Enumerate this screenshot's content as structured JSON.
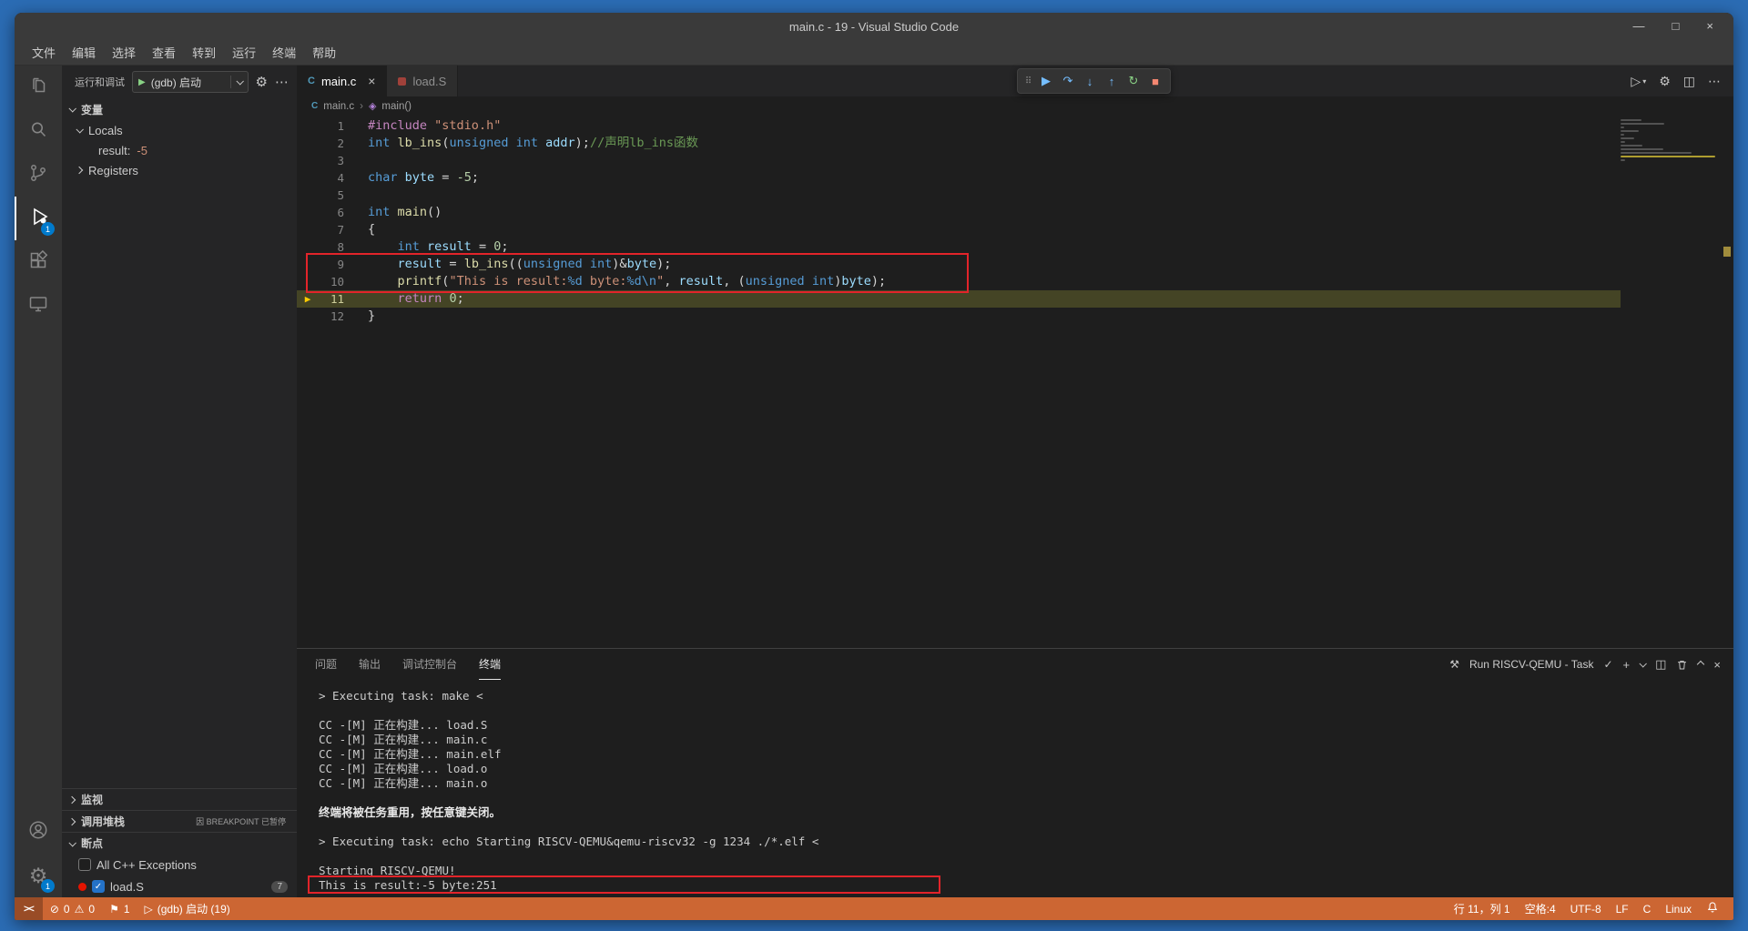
{
  "colors": {
    "frame": "#2b6cb4",
    "statusbar": "#cc6633",
    "annotation": "#e2242a",
    "badge": "#007acc",
    "current_line_arrow": "#ffcc00"
  },
  "window": {
    "title": "main.c - 19 - Visual Studio Code",
    "controls": {
      "minimize": "—",
      "maximize": "□",
      "close": "×"
    }
  },
  "menu": {
    "items": [
      "文件",
      "编辑",
      "选择",
      "查看",
      "转到",
      "运行",
      "终端",
      "帮助"
    ]
  },
  "activity_badges": {
    "debug": "1",
    "settings": "1"
  },
  "sidebar": {
    "title": "运行和调试",
    "launch_config": "(gdb) 启动",
    "variables_label": "变量",
    "locals_label": "Locals",
    "registers_label": "Registers",
    "variables": [
      {
        "name": "result:",
        "value": "-5"
      }
    ],
    "watch_label": "监视",
    "callstack_label": "调用堆栈",
    "callstack_desc": "因 BREAKPOINT 已暂停",
    "breakpoints_label": "断点",
    "breakpoints": [
      {
        "label": "All C++ Exceptions",
        "checked": false
      },
      {
        "label": "load.S",
        "checked": true,
        "badge": "7"
      }
    ]
  },
  "tabs": [
    {
      "label": "main.c"
    },
    {
      "label": "load.S"
    }
  ],
  "breadcrumb": {
    "file": "main.c",
    "symbol": "main()"
  },
  "debug_toolbar": {
    "buttons": [
      "continue",
      "step-over",
      "step-into",
      "step-out",
      "restart",
      "stop"
    ]
  },
  "editor_actions": [
    "run",
    "settings",
    "split-editor",
    "more-actions"
  ],
  "editor": {
    "current_line": 11,
    "lines": [
      {
        "num": 1,
        "tokens": [
          [
            "pp",
            "#include"
          ],
          [
            "pln",
            " "
          ],
          [
            "str",
            "\"stdio.h\""
          ]
        ]
      },
      {
        "num": 2,
        "tokens": [
          [
            "kw",
            "int"
          ],
          [
            "pln",
            " "
          ],
          [
            "fn",
            "lb_ins"
          ],
          [
            "pln",
            "("
          ],
          [
            "kw",
            "unsigned"
          ],
          [
            "pln",
            " "
          ],
          [
            "kw",
            "int"
          ],
          [
            "pln",
            " "
          ],
          [
            "var",
            "addr"
          ],
          [
            "pln",
            ");"
          ],
          [
            "cmt",
            "//声明lb_ins函数"
          ]
        ]
      },
      {
        "num": 3,
        "tokens": []
      },
      {
        "num": 4,
        "tokens": [
          [
            "kw",
            "char"
          ],
          [
            "pln",
            " "
          ],
          [
            "var",
            "byte"
          ],
          [
            "pln",
            " = "
          ],
          [
            "num",
            "-5"
          ],
          [
            "pln",
            ";"
          ]
        ]
      },
      {
        "num": 5,
        "tokens": []
      },
      {
        "num": 6,
        "tokens": [
          [
            "kw",
            "int"
          ],
          [
            "pln",
            " "
          ],
          [
            "fn",
            "main"
          ],
          [
            "pln",
            "()"
          ]
        ]
      },
      {
        "num": 7,
        "tokens": [
          [
            "pln",
            "{"
          ]
        ]
      },
      {
        "num": 8,
        "tokens": [
          [
            "pln",
            "    "
          ],
          [
            "kw",
            "int"
          ],
          [
            "pln",
            " "
          ],
          [
            "var",
            "result"
          ],
          [
            "pln",
            " = "
          ],
          [
            "num",
            "0"
          ],
          [
            "pln",
            ";"
          ]
        ]
      },
      {
        "num": 9,
        "tokens": [
          [
            "pln",
            "    "
          ],
          [
            "var",
            "result"
          ],
          [
            "pln",
            " = "
          ],
          [
            "fn",
            "lb_ins"
          ],
          [
            "pln",
            "(("
          ],
          [
            "kw",
            "unsigned"
          ],
          [
            "pln",
            " "
          ],
          [
            "kw",
            "int"
          ],
          [
            "pln",
            ")&"
          ],
          [
            "var",
            "byte"
          ],
          [
            "pln",
            ");"
          ]
        ]
      },
      {
        "num": 10,
        "tokens": [
          [
            "pln",
            "    "
          ],
          [
            "fn",
            "printf"
          ],
          [
            "pln",
            "("
          ],
          [
            "str",
            "\"This is result:"
          ],
          [
            "esc",
            "%d"
          ],
          [
            "str",
            " byte:"
          ],
          [
            "esc",
            "%d"
          ],
          [
            "esc",
            "\\n"
          ],
          [
            "str",
            "\""
          ],
          [
            "pln",
            ", "
          ],
          [
            "var",
            "result"
          ],
          [
            "pln",
            ", ("
          ],
          [
            "kw",
            "unsigned"
          ],
          [
            "pln",
            " "
          ],
          [
            "kw",
            "int"
          ],
          [
            "pln",
            ")"
          ],
          [
            "var",
            "byte"
          ],
          [
            "pln",
            ");"
          ]
        ]
      },
      {
        "num": 11,
        "tokens": [
          [
            "pln",
            "    "
          ],
          [
            "pp",
            "return"
          ],
          [
            "pln",
            " "
          ],
          [
            "num",
            "0"
          ],
          [
            "pln",
            ";"
          ]
        ]
      },
      {
        "num": 12,
        "tokens": [
          [
            "pln",
            "}"
          ]
        ]
      }
    ]
  },
  "panel": {
    "tabs": [
      "问题",
      "输出",
      "调试控制台",
      "终端"
    ],
    "active_tab": "终端",
    "task_label": "Run RISCV-QEMU - Task",
    "terminal_lines": [
      {
        "text": "> Executing task: make <"
      },
      {
        "text": ""
      },
      {
        "text": "CC -[M] 正在构建... load.S"
      },
      {
        "text": "CC -[M] 正在构建... main.c"
      },
      {
        "text": "CC -[M] 正在构建... main.elf"
      },
      {
        "text": "CC -[M] 正在构建... load.o"
      },
      {
        "text": "CC -[M] 正在构建... main.o"
      },
      {
        "text": ""
      },
      {
        "text": "终端将被任务重用，按任意键关闭。",
        "bold": true
      },
      {
        "text": ""
      },
      {
        "text": "> Executing task: echo Starting RISCV-QEMU&qemu-riscv32 -g 1234 ./*.elf <"
      },
      {
        "text": ""
      },
      {
        "text": "Starting RISCV-QEMU!"
      },
      {
        "text": "This is result:-5 byte:251"
      }
    ]
  },
  "statusbar": {
    "errors": "0",
    "warnings": "0",
    "flag_count": "1",
    "debug_status": "(gdb) 启动 (19)",
    "line_col": "行 11，列 1",
    "spaces": "空格:4",
    "encoding": "UTF-8",
    "eol": "LF",
    "language": "C",
    "os": "Linux"
  }
}
